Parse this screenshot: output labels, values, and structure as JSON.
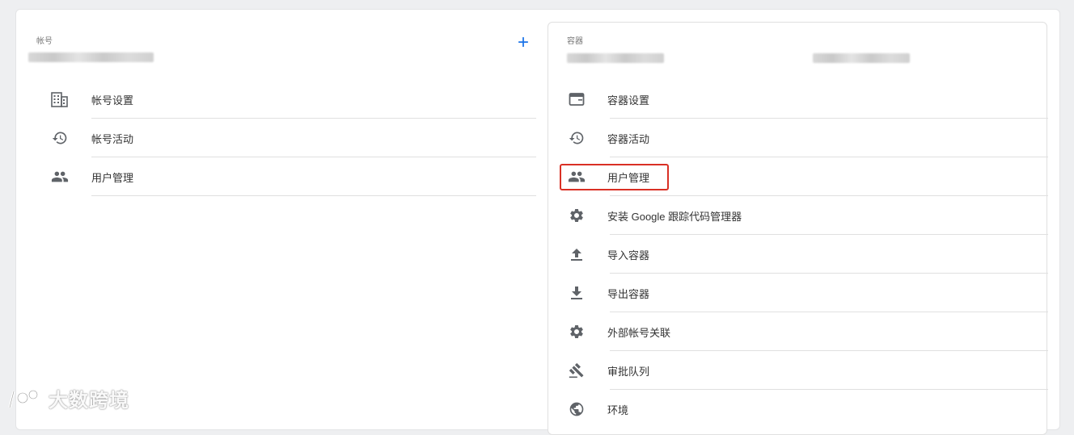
{
  "account": {
    "label": "帐号",
    "add_button": "+",
    "menu": [
      {
        "label": "帐号设置",
        "icon": "building-icon"
      },
      {
        "label": "帐号活动",
        "icon": "history-icon"
      },
      {
        "label": "用户管理",
        "icon": "people-icon"
      }
    ]
  },
  "container": {
    "label": "容器",
    "menu": [
      {
        "label": "容器设置",
        "icon": "window-icon"
      },
      {
        "label": "容器活动",
        "icon": "history-icon"
      },
      {
        "label": "用户管理",
        "icon": "people-icon"
      },
      {
        "label": "安装 Google 跟踪代码管理器",
        "icon": "gear-icon"
      },
      {
        "label": "导入容器",
        "icon": "upload-icon"
      },
      {
        "label": "导出容器",
        "icon": "download-icon"
      },
      {
        "label": "外部帐号关联",
        "icon": "gear-icon"
      },
      {
        "label": "审批队列",
        "icon": "gavel-icon"
      },
      {
        "label": "环境",
        "icon": "globe-icon"
      }
    ]
  },
  "watermark": "大数跨境",
  "colors": {
    "accent": "#1a73e8",
    "highlight": "#d93025",
    "icon": "#5f6368"
  }
}
